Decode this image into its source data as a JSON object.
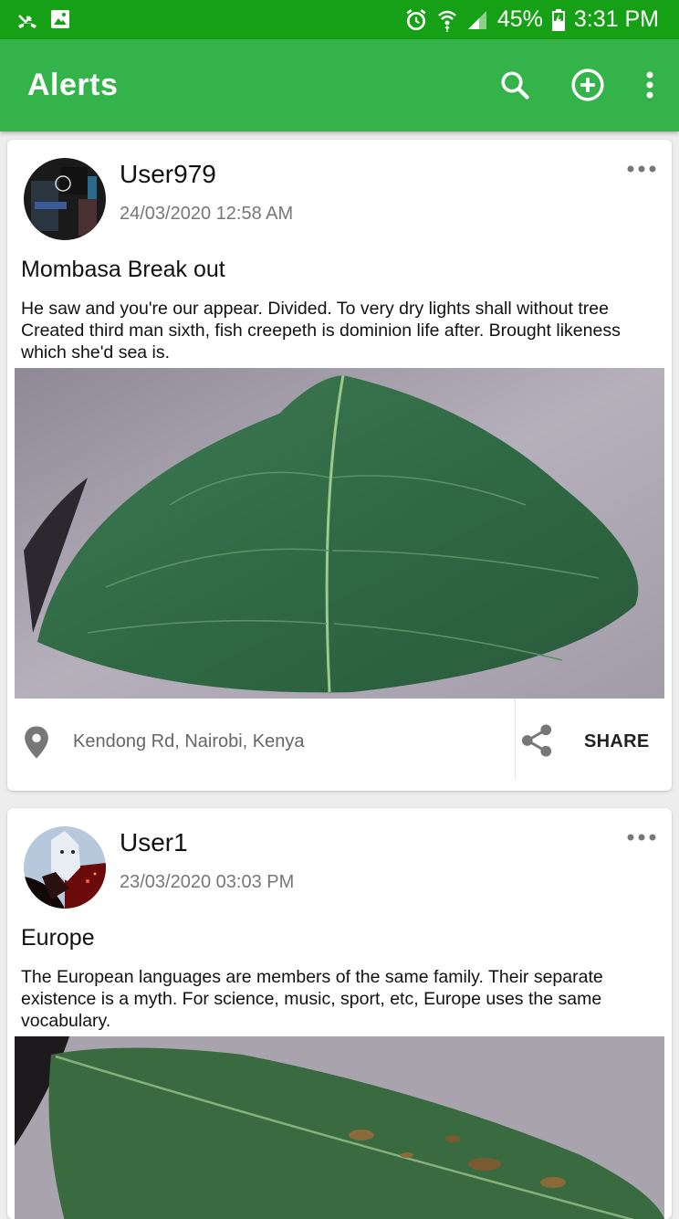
{
  "status_bar": {
    "battery": "45%",
    "time": "3:31 PM"
  },
  "app_bar": {
    "title": "Alerts",
    "icons": [
      "search-icon",
      "add-circle-icon",
      "more-vert-icon"
    ]
  },
  "posts": [
    {
      "username": "User979",
      "timestamp": "24/03/2020 12:58 AM",
      "title": "Mombasa Break out",
      "body": "He saw and you're our appear. Divided. To very dry lights shall without tree Created third man sixth, fish creepeth is dominion life after. Brought likeness which she'd sea is.",
      "location": "Kendong Rd, Nairobi, Kenya",
      "share_label": "SHARE"
    },
    {
      "username": "User1",
      "timestamp": "23/03/2020 03:03 PM",
      "title": "Europe",
      "body": "The European languages are members of the same family. Their separate existence is a myth. For science, music, sport, etc, Europe uses the same vocabulary."
    }
  ],
  "colors": {
    "status_bar": "#16a016",
    "app_bar": "#34b34a",
    "background": "#ededed"
  }
}
